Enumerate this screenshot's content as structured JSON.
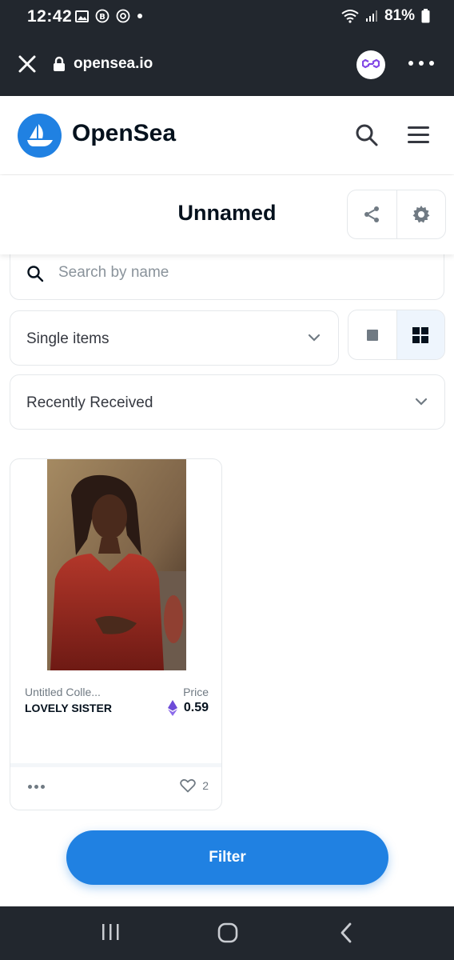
{
  "status_bar": {
    "time": "12:42",
    "battery": "81%"
  },
  "browser": {
    "url": "opensea.io"
  },
  "header": {
    "brand": "OpenSea"
  },
  "page": {
    "title": "Unnamed"
  },
  "search": {
    "placeholder": "Search by name"
  },
  "filters": {
    "item_type": "Single items",
    "sort": "Recently Received"
  },
  "cards": [
    {
      "collection": "Untitled Colle...",
      "name": "LOVELY SISTER",
      "price_label": "Price",
      "price": "0.59",
      "likes": "2"
    }
  ],
  "filter_button": "Filter",
  "colors": {
    "accent": "#2081e2",
    "dark_bar": "#22272e",
    "polygon": "#8247e5"
  }
}
